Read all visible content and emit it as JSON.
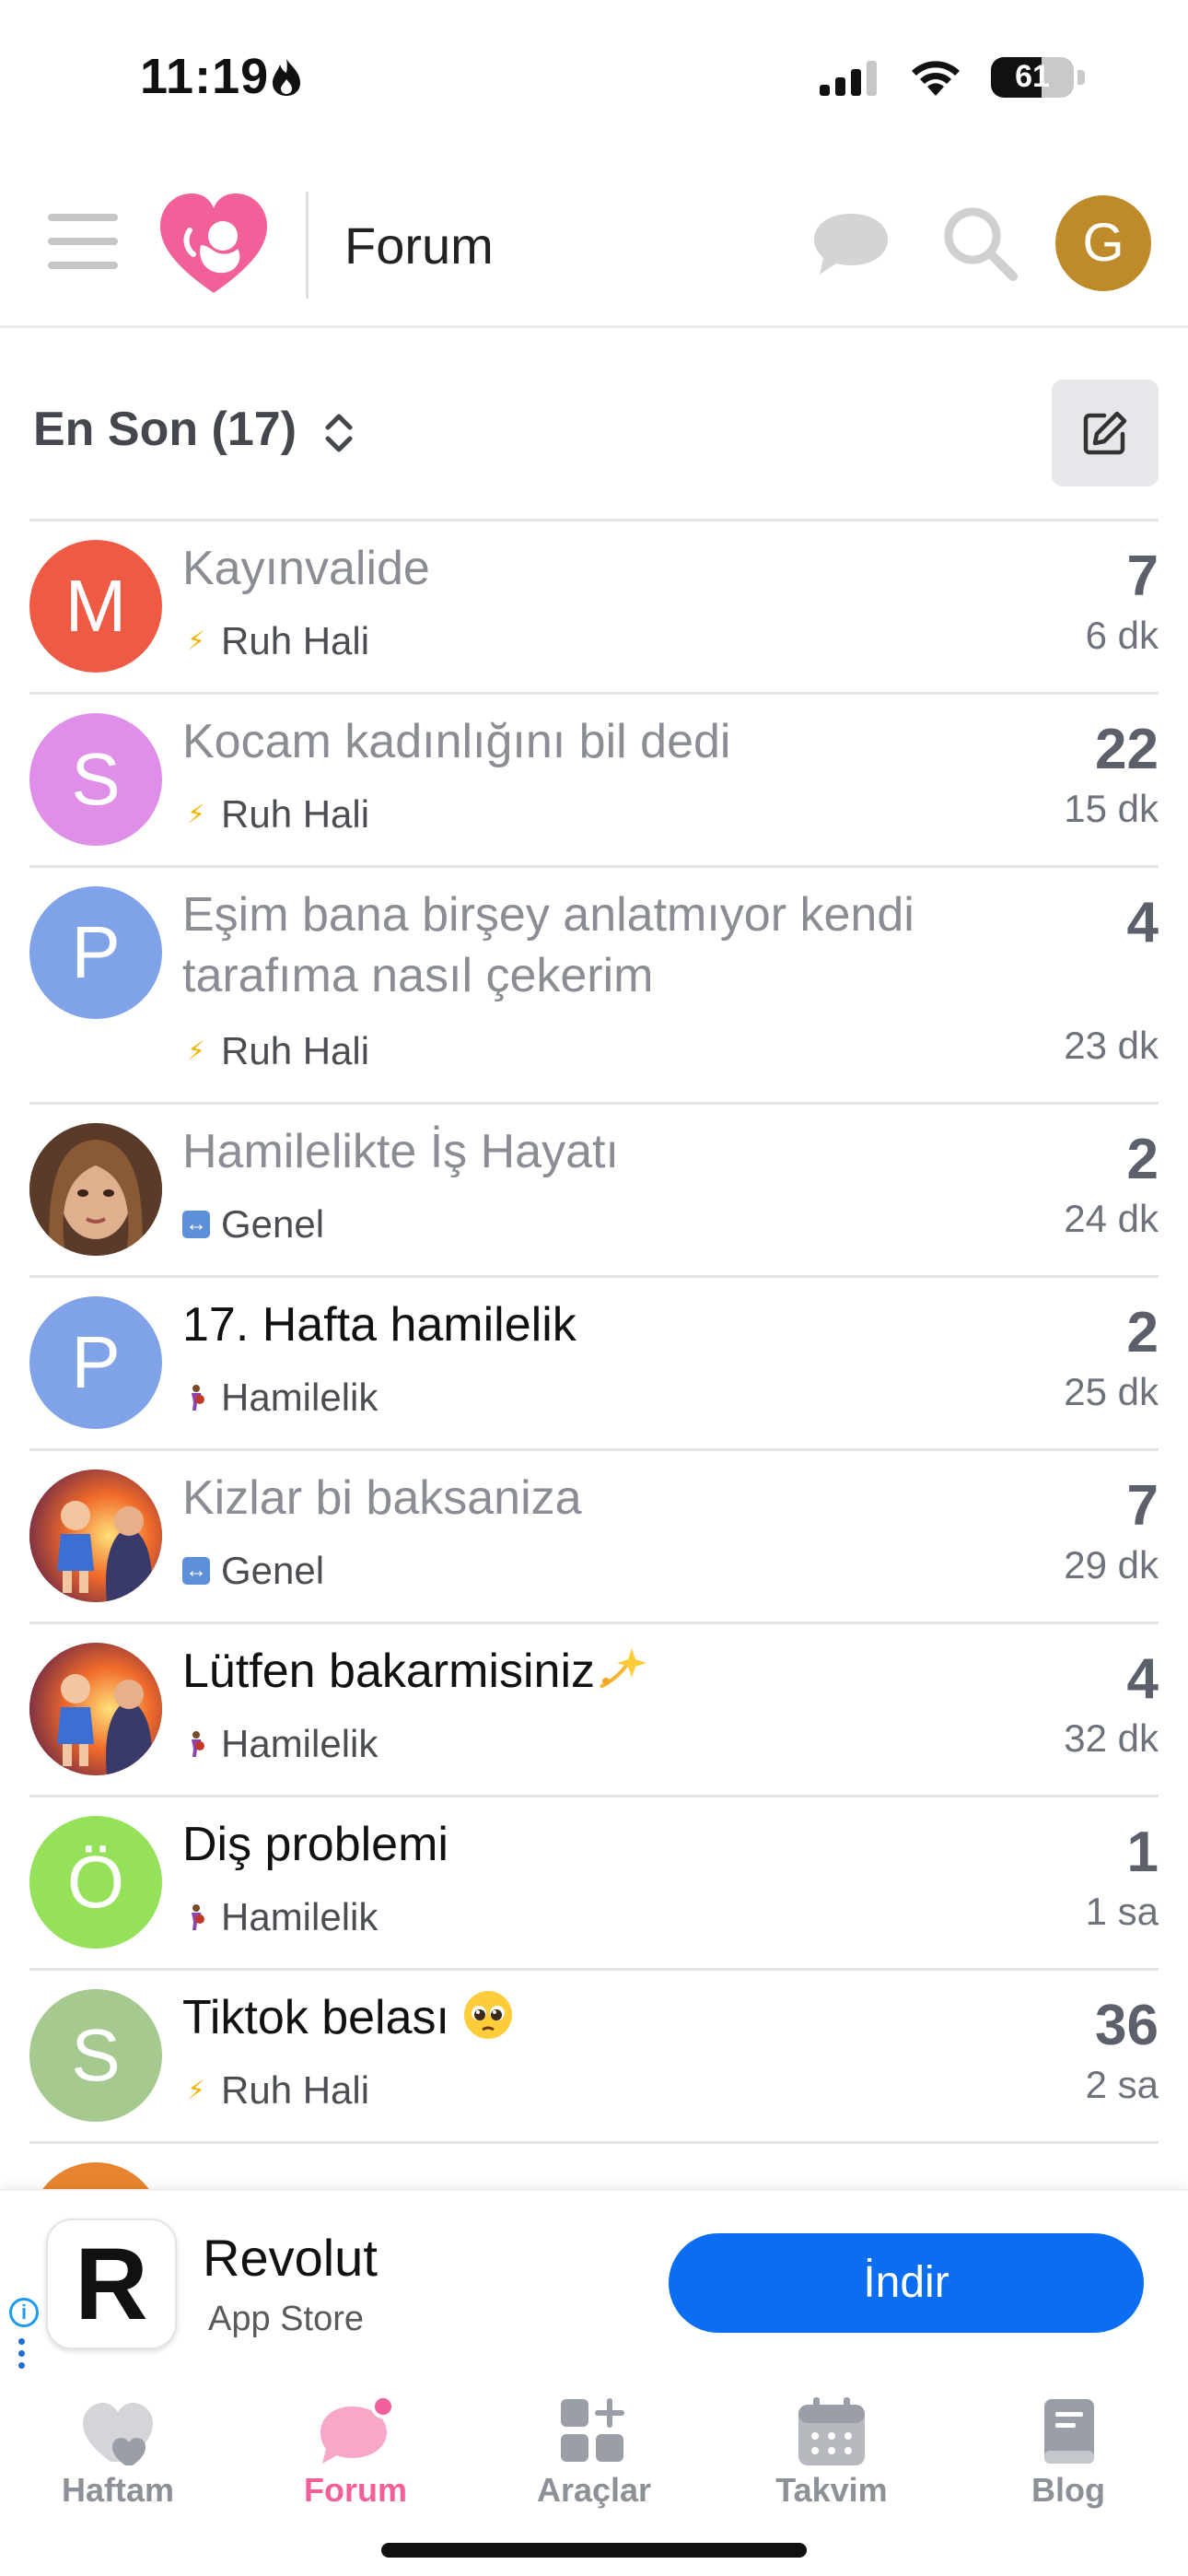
{
  "status_bar": {
    "time": "11:19",
    "battery": "61",
    "battery_level": 0.61
  },
  "header": {
    "title": "Forum",
    "avatar_letter": "G",
    "avatar_color": "#bf8a2a"
  },
  "sort": {
    "label": "En Son (17)"
  },
  "topics": [
    {
      "avatar_letter": "M",
      "avatar_color": "#ef5a45",
      "title": "Kayınvalide",
      "read": true,
      "category": "Ruh Hali",
      "category_icon": "bolt-icon",
      "count": "7",
      "time": "6 dk"
    },
    {
      "avatar_letter": "S",
      "avatar_color": "#e08fe8",
      "title": "Kocam kadınlığını bil dedi",
      "read": true,
      "category": "Ruh Hali",
      "category_icon": "bolt-icon",
      "count": "22",
      "time": "15 dk"
    },
    {
      "avatar_letter": "P",
      "avatar_color": "#7fa2e8",
      "title": "Eşim bana birşey anlatmıyor kendi tarafıma nasıl çekerim",
      "read": true,
      "category": "Ruh Hali",
      "category_icon": "bolt-icon",
      "count": "4",
      "time": "23 dk"
    },
    {
      "avatar_letter": "",
      "avatar_color": "#6b4a36",
      "title": "Hamilelikte İş Hayatı",
      "read": true,
      "category": "Genel",
      "category_icon": "left-right-arrows-icon",
      "count": "2",
      "time": "24 dk"
    },
    {
      "avatar_letter": "P",
      "avatar_color": "#7fa2e8",
      "title": "17. Hafta hamilelik",
      "read": false,
      "category": "Hamilelik",
      "category_icon": "pregnant-woman-icon",
      "count": "2",
      "time": "25 dk"
    },
    {
      "avatar_letter": "",
      "avatar_color": "#c94a2a",
      "title": "Kizlar bi baksaniza",
      "read": true,
      "category": "Genel",
      "category_icon": "left-right-arrows-icon",
      "count": "7",
      "time": "29 dk"
    },
    {
      "avatar_letter": "",
      "avatar_color": "#c94a2a",
      "title": "Lütfen bakarmisiniz",
      "read": false,
      "category": "Hamilelik",
      "category_icon": "pregnant-woman-icon",
      "count": "4",
      "time": "32 dk"
    },
    {
      "avatar_letter": "Ö",
      "avatar_color": "#95e25a",
      "title": "Diş problemi",
      "read": false,
      "category": "Hamilelik",
      "category_icon": "pregnant-woman-icon",
      "count": "1",
      "time": "1 sa"
    },
    {
      "avatar_letter": "S",
      "avatar_color": "#a6c98f",
      "title": "Tiktok belası",
      "read": false,
      "category": "Ruh Hali",
      "category_icon": "bolt-icon",
      "count": "36",
      "time": "2 sa"
    }
  ],
  "ad": {
    "app_letter": "R",
    "title": "Revolut",
    "subtitle": "App Store",
    "install_label": "İndir"
  },
  "tabs": [
    {
      "label": "Haftam",
      "icon": "heart-icon",
      "active": false
    },
    {
      "label": "Forum",
      "icon": "forum-chat-icon",
      "active": true
    },
    {
      "label": "Araçlar",
      "icon": "tools-grid-icon",
      "active": false
    },
    {
      "label": "Takvim",
      "icon": "calendar-icon",
      "active": false
    },
    {
      "label": "Blog",
      "icon": "book-icon",
      "active": false
    }
  ],
  "colors": {
    "accent": "#f2609a",
    "install": "#0a6df2",
    "muted": "#8c9097"
  }
}
